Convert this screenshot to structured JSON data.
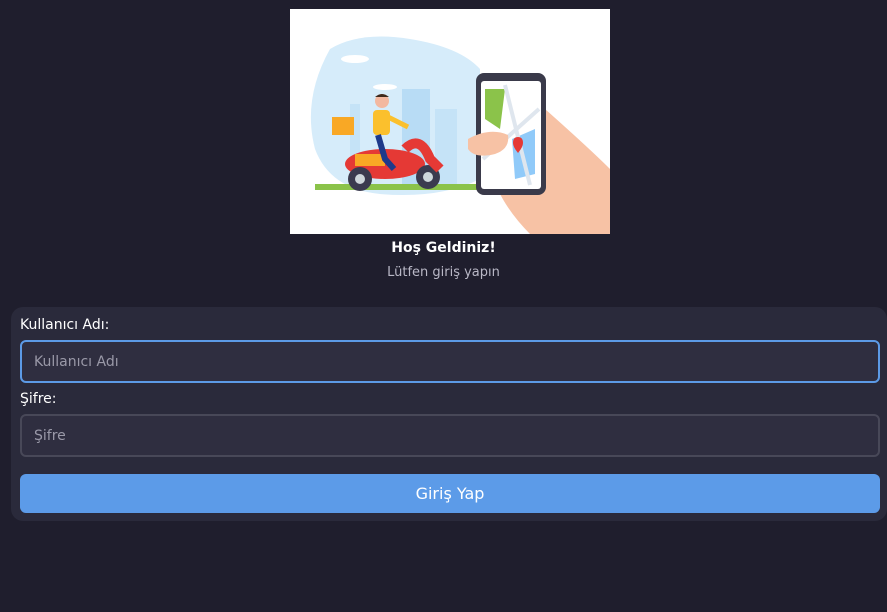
{
  "header": {
    "title": "Hoş Geldiniz!",
    "subtitle": "Lütfen giriş yapın"
  },
  "form": {
    "username_label": "Kullanıcı Adı:",
    "username_placeholder": "Kullanıcı Adı",
    "username_value": "",
    "password_label": "Şifre:",
    "password_placeholder": "Şifre",
    "password_value": "",
    "submit_label": "Giriş Yap"
  },
  "illustration": {
    "icon": "delivery-scooter-map-phone-illustration"
  },
  "colors": {
    "background": "#1f1e2d",
    "card": "#2a2a3b",
    "accent": "#5c9be8",
    "focus_border": "#5c9ae6"
  }
}
